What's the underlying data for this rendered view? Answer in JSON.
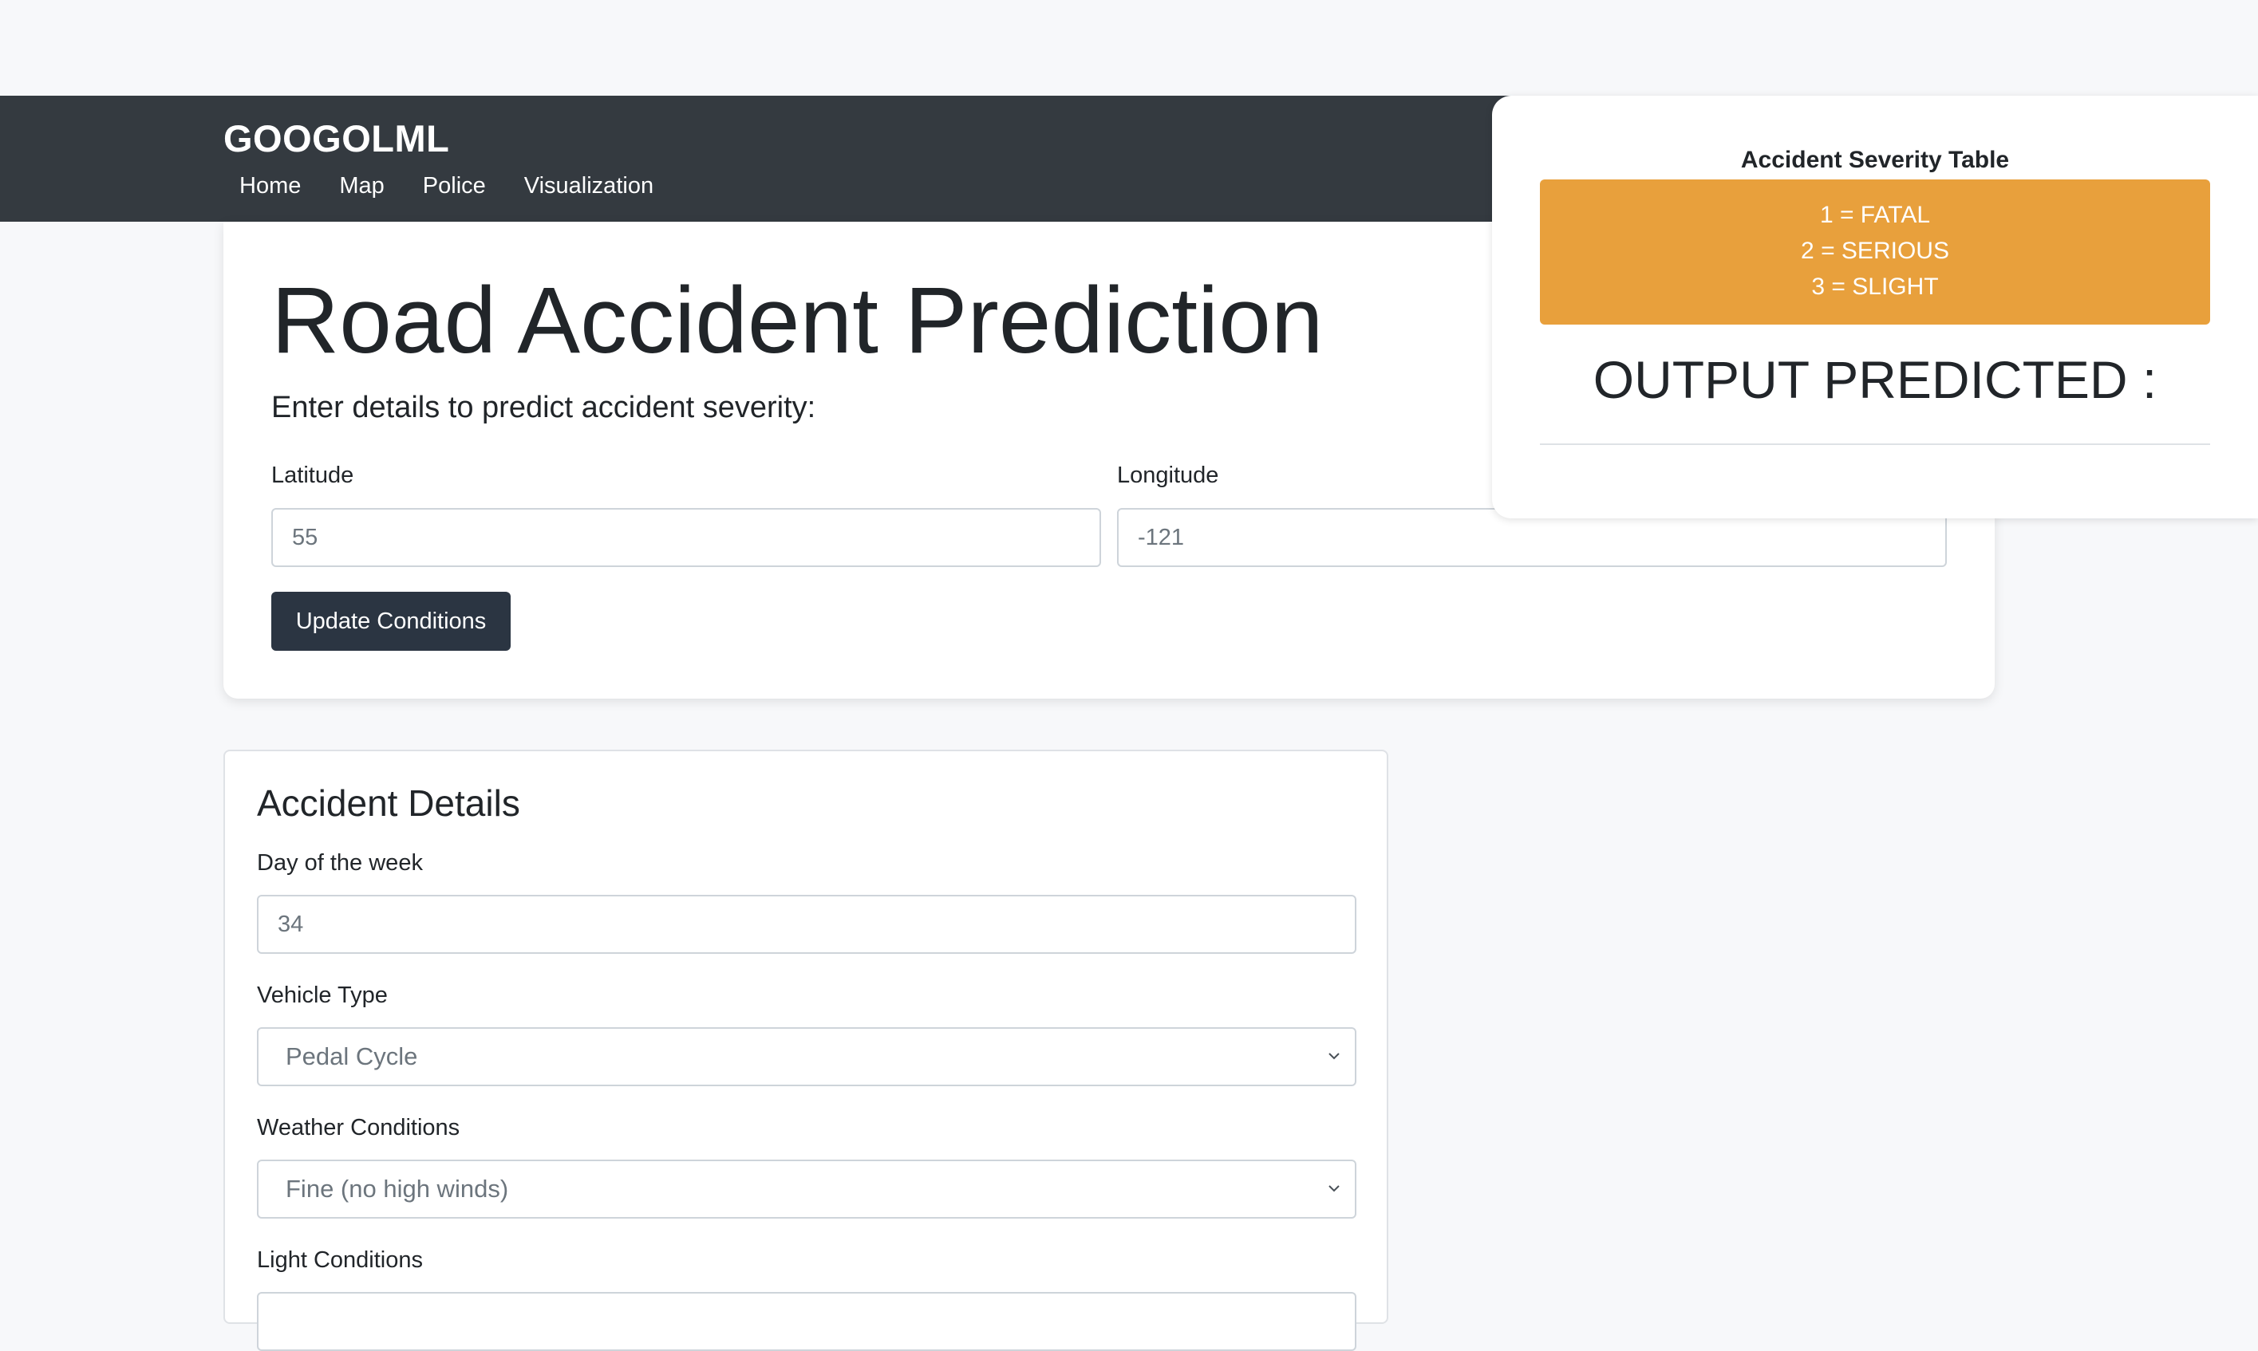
{
  "navbar": {
    "brand": "GOOGOLML",
    "links": [
      "Home",
      "Map",
      "Police",
      "Visualization"
    ]
  },
  "hero": {
    "title": "Road Accident Prediction",
    "subtitle": "Enter details to predict accident severity:",
    "latitude": {
      "label": "Latitude",
      "placeholder": "55"
    },
    "longitude": {
      "label": "Longitude",
      "placeholder": "-121"
    },
    "update_button": "Update Conditions"
  },
  "severity_panel": {
    "title": "Accident Severity Table",
    "levels": [
      "1 = FATAL",
      "2 = SERIOUS",
      "3 = SLIGHT"
    ],
    "output_label": "OUTPUT PREDICTED :",
    "accent_color": "#e8a03c"
  },
  "details": {
    "title": "Accident Details",
    "day_of_week": {
      "label": "Day of the week",
      "placeholder": "34"
    },
    "vehicle_type": {
      "label": "Vehicle Type",
      "selected": "Pedal Cycle"
    },
    "weather": {
      "label": "Weather Conditions",
      "selected": "Fine (no high winds)"
    },
    "light": {
      "label": "Light Conditions"
    }
  },
  "colors": {
    "navbar_bg": "#343a40",
    "button_bg": "#2b3542",
    "page_bg": "#f7f8fa"
  }
}
